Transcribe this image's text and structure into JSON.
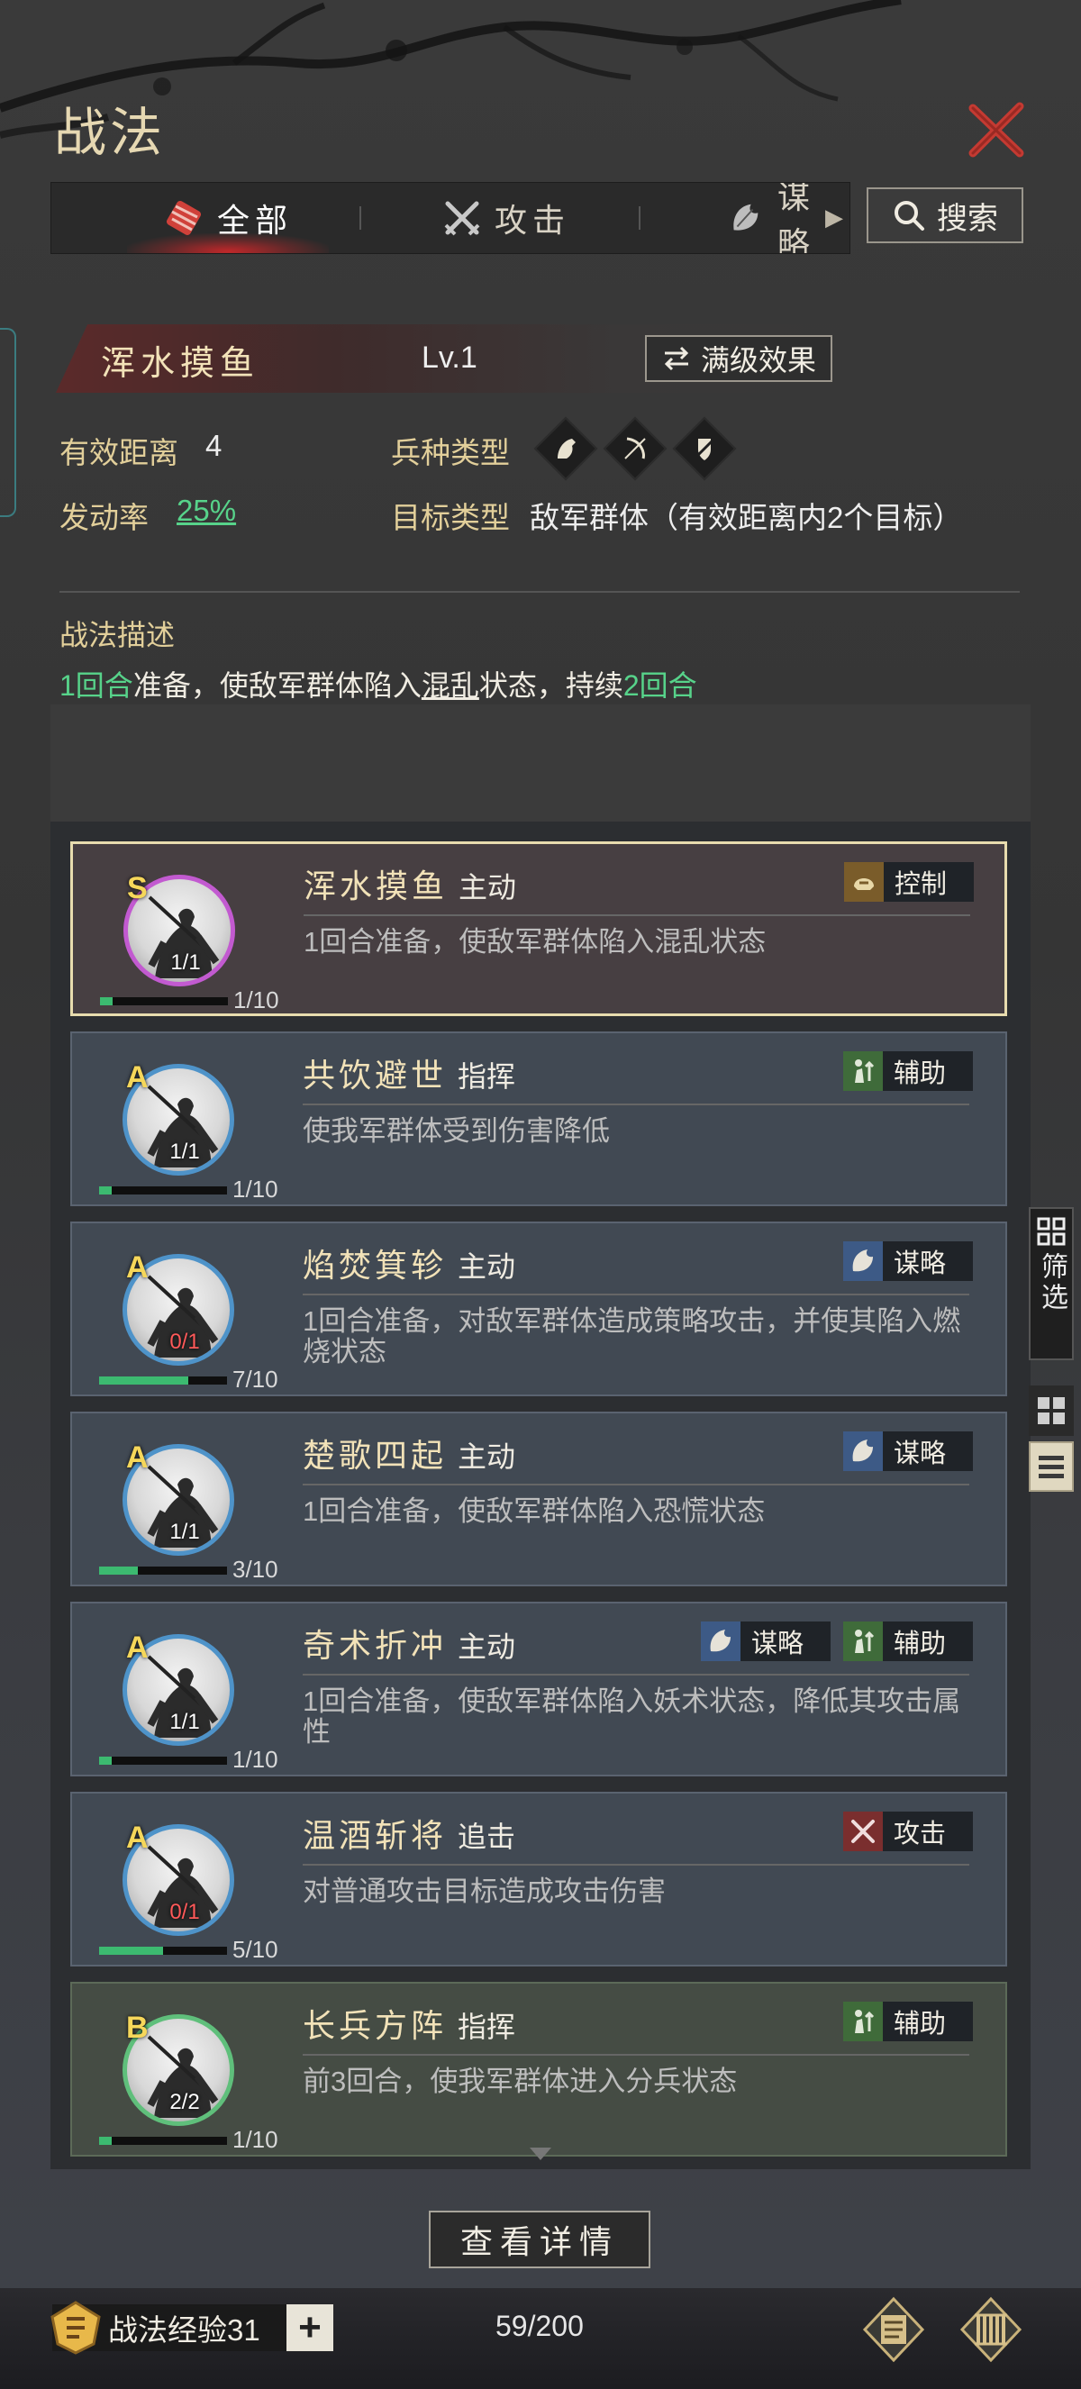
{
  "title": "战法",
  "tabs": [
    {
      "label": "全部",
      "icon": "bundle-icon",
      "active": true
    },
    {
      "label": "攻击",
      "icon": "crossed-swords-icon",
      "active": false
    },
    {
      "label": "谋略",
      "icon": "scheme-icon",
      "active": false
    }
  ],
  "search_label": "搜索",
  "skill": {
    "name": "浑水摸鱼",
    "level": "Lv.1",
    "max_effect_label": "满级效果",
    "range_label": "有效距离",
    "range_value": "4",
    "troop_label": "兵种类型",
    "troop_icons": [
      "cavalry-icon",
      "archer-icon",
      "shield-icon"
    ],
    "rate_label": "发动率",
    "rate_value": "25%",
    "target_label": "目标类型",
    "target_value": "敌军群体（有效距离内2个目标）",
    "desc_label": "战法描述",
    "desc": {
      "p1": "1回合",
      "p2": "准备，使敌军群体陷入",
      "p3": "混乱",
      "p4": "状态，持续",
      "p5": "2回合"
    }
  },
  "cards": [
    {
      "name": "浑水摸鱼",
      "type": "主动",
      "grade": "S",
      "equip": "1/1",
      "xp": "1/10",
      "xp_ratio": 0.1,
      "tags": [
        {
          "label": "控制",
          "icon": "helmet-icon",
          "color": "#7a5c2a"
        }
      ],
      "desc": "1回合准备，使敌军群体陷入混乱状态"
    },
    {
      "name": "共饮避世",
      "type": "指挥",
      "grade": "A",
      "equip": "1/1",
      "xp": "1/10",
      "xp_ratio": 0.1,
      "tags": [
        {
          "label": "辅助",
          "icon": "support-icon",
          "color": "#3f6b3a"
        }
      ],
      "desc": "使我军群体受到伤害降低"
    },
    {
      "name": "焰焚箕轸",
      "type": "主动",
      "grade": "A",
      "equip": "0/1",
      "xp": "7/10",
      "xp_ratio": 0.7,
      "tags": [
        {
          "label": "谋略",
          "icon": "scheme-icon",
          "color": "#3d5a86"
        }
      ],
      "desc": "1回合准备，对敌军群体造成策略攻击，并使其陷入燃烧状态"
    },
    {
      "name": "楚歌四起",
      "type": "主动",
      "grade": "A",
      "equip": "1/1",
      "xp": "3/10",
      "xp_ratio": 0.3,
      "tags": [
        {
          "label": "谋略",
          "icon": "scheme-icon",
          "color": "#3d5a86"
        }
      ],
      "desc": "1回合准备，使敌军群体陷入恐慌状态"
    },
    {
      "name": "奇术折冲",
      "type": "主动",
      "grade": "A",
      "equip": "1/1",
      "xp": "1/10",
      "xp_ratio": 0.1,
      "tags": [
        {
          "label": "谋略",
          "icon": "scheme-icon",
          "color": "#3d5a86"
        },
        {
          "label": "辅助",
          "icon": "support-icon",
          "color": "#3f6b3a"
        }
      ],
      "desc": "1回合准备，使敌军群体陷入妖术状态，降低其攻击属性"
    },
    {
      "name": "温酒斩将",
      "type": "追击",
      "grade": "A",
      "equip": "0/1",
      "xp": "5/10",
      "xp_ratio": 0.5,
      "tags": [
        {
          "label": "攻击",
          "icon": "crossed-swords-icon",
          "color": "#7a2e2e"
        }
      ],
      "desc": "对普通攻击目标造成攻击伤害"
    },
    {
      "name": "长兵方阵",
      "type": "指挥",
      "grade": "B",
      "equip": "2/2",
      "xp": "1/10",
      "xp_ratio": 0.1,
      "tags": [
        {
          "label": "辅助",
          "icon": "support-icon",
          "color": "#3f6b3a"
        }
      ],
      "desc": "前3回合，使我军群体进入分兵状态"
    }
  ],
  "filter_label": "筛选",
  "detail_label": "查看详情",
  "exp_label": "战法经验31",
  "plus_label": "+",
  "count": "59/200",
  "colors": {
    "accent_green": "#57d38a",
    "gold": "#e2cf9a",
    "close_red": "#c0282a"
  }
}
